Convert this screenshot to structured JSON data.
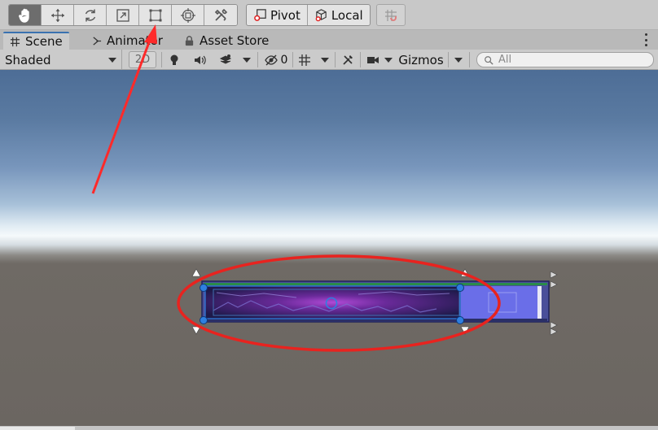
{
  "toolbar": {
    "tools": [
      {
        "name": "hand-tool",
        "icon": "hand-icon",
        "active": true
      },
      {
        "name": "move-tool",
        "icon": "move-arrows-icon"
      },
      {
        "name": "rotate-tool",
        "icon": "rotate-icon"
      },
      {
        "name": "scale-tool",
        "icon": "scale-icon"
      },
      {
        "name": "rect-tool",
        "icon": "rect-transform-icon"
      },
      {
        "name": "transform-tool",
        "icon": "transform-icon"
      },
      {
        "name": "custom-tool",
        "icon": "tools-icon"
      }
    ],
    "pivot_label": "Pivot",
    "local_label": "Local"
  },
  "tabs": [
    {
      "label": "Scene",
      "icon": "grid-icon"
    },
    {
      "label": "Animator",
      "icon": "animator-icon"
    },
    {
      "label": "Asset Store",
      "icon": "lock-icon"
    }
  ],
  "scene_options": {
    "shading_mode": "Shaded",
    "mode_2d": "2D",
    "hidden_count": "0",
    "gizmos_label": "Gizmos",
    "search_placeholder": "All"
  },
  "annotation": {
    "arrow_color": "#ff2a2a",
    "ellipse_color": "#e8231f"
  }
}
